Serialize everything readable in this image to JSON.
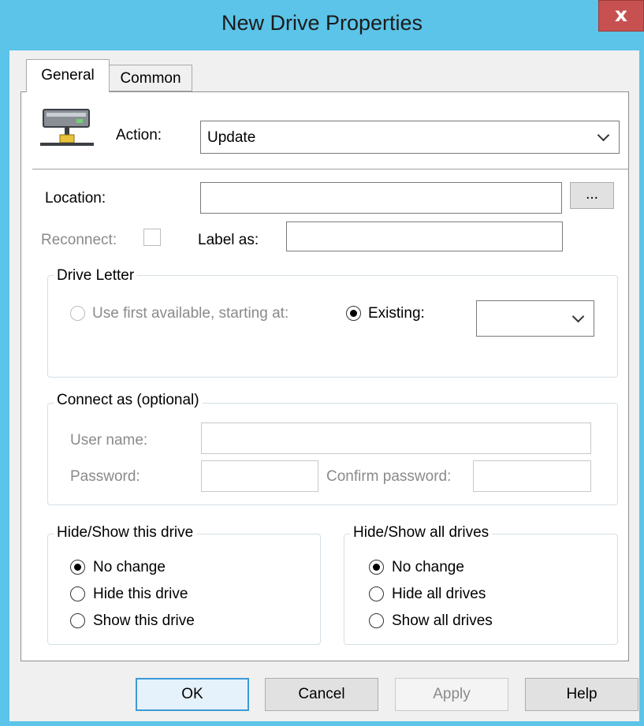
{
  "window": {
    "title": "New Drive Properties",
    "close_label": "x"
  },
  "tabs": [
    {
      "label": "General"
    },
    {
      "label": "Common"
    }
  ],
  "action": {
    "label": "Action:",
    "value": "Update"
  },
  "location": {
    "label": "Location:",
    "value": "",
    "browse_label": "..."
  },
  "reconnect": {
    "label": "Reconnect:",
    "checked": false
  },
  "label_as": {
    "label": "Label as:",
    "value": ""
  },
  "drive_letter": {
    "title": "Drive Letter",
    "use_first_label": "Use first available, starting at:",
    "existing_label": "Existing:",
    "existing_value": "",
    "selected": "existing"
  },
  "connect_as": {
    "title": "Connect as (optional)",
    "username_label": "User name:",
    "password_label": "Password:",
    "confirm_label": "Confirm password:"
  },
  "hide_show_this": {
    "title": "Hide/Show this drive",
    "options": [
      "No change",
      "Hide this drive",
      "Show this drive"
    ],
    "selected": "No change"
  },
  "hide_show_all": {
    "title": "Hide/Show all drives",
    "options": [
      "No change",
      "Hide all drives",
      "Show all drives"
    ],
    "selected": "No change"
  },
  "buttons": {
    "ok": "OK",
    "cancel": "Cancel",
    "apply": "Apply",
    "help": "Help"
  },
  "colors": {
    "titlebar": "#5bc4e8",
    "close": "#c75050",
    "panel": "#ffffff",
    "disabled_text": "#8a8a8a"
  },
  "icons": {
    "drive": "network-drive-icon",
    "dropdown": "chevron-down-icon"
  }
}
